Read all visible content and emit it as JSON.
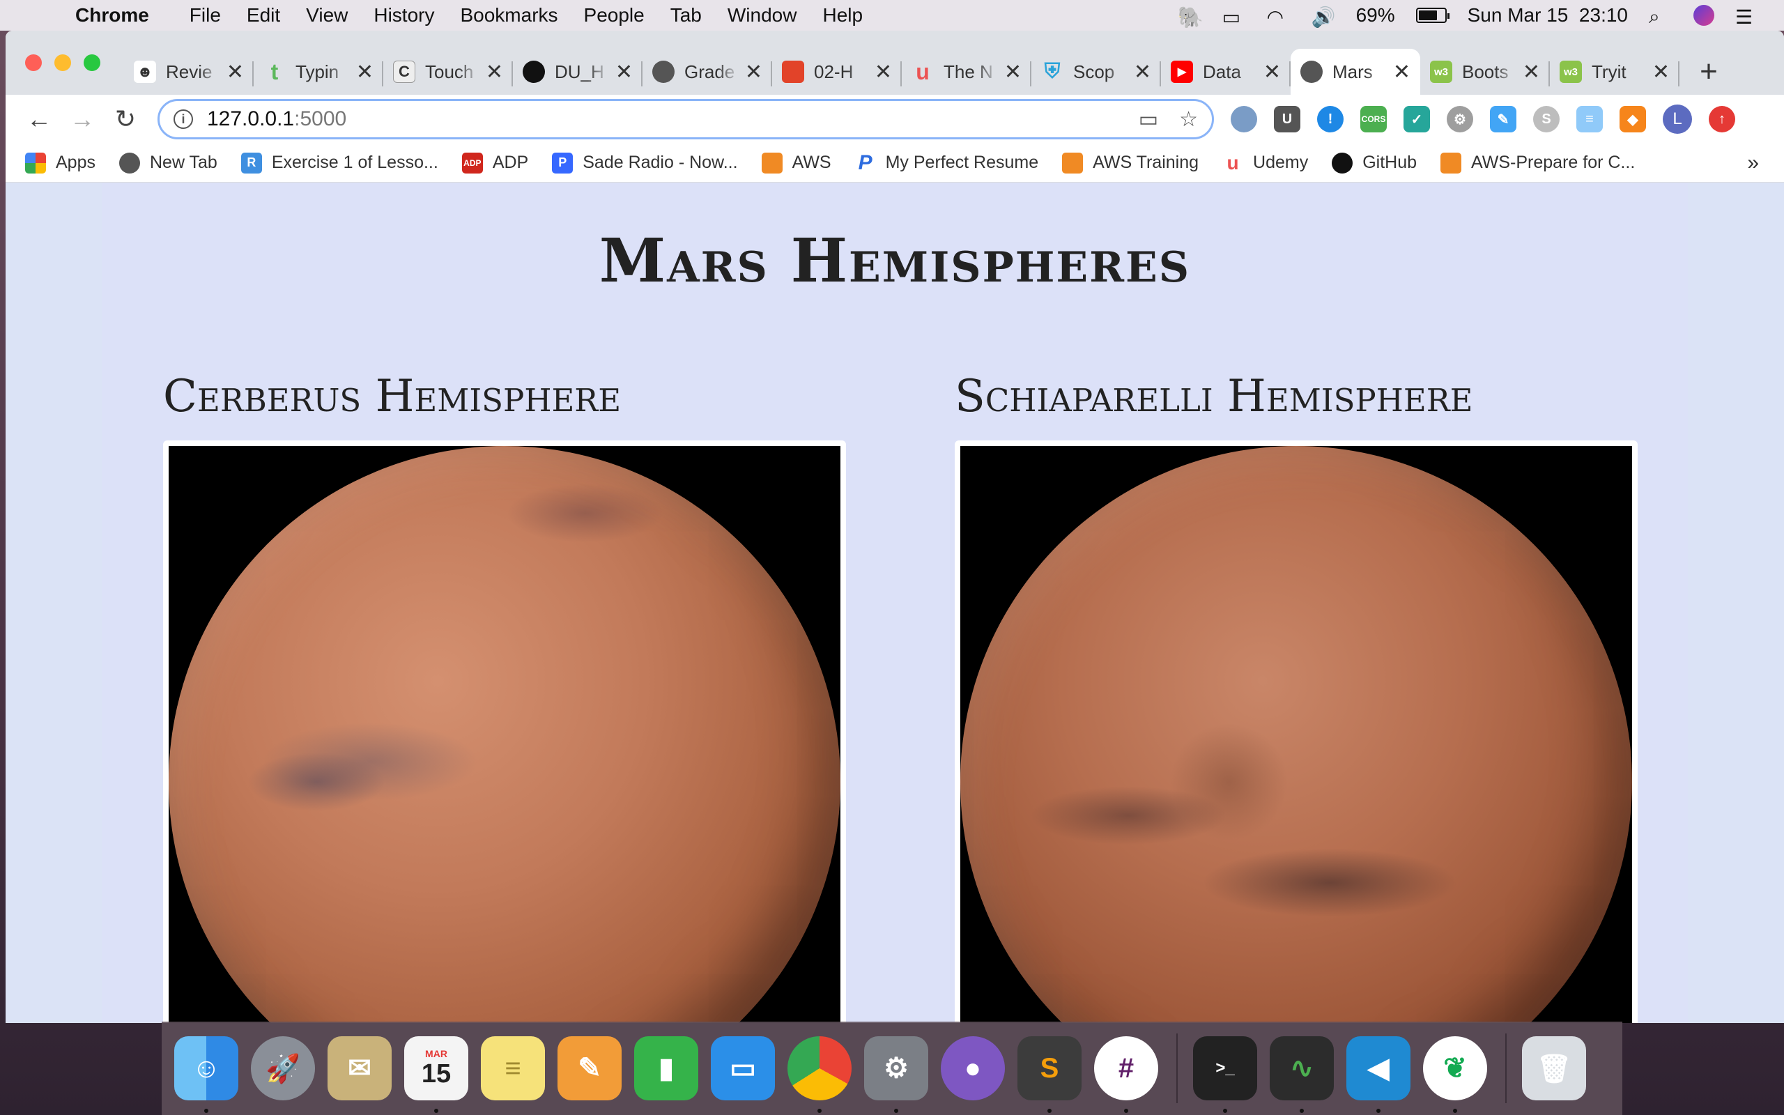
{
  "menubar": {
    "app_name": "Chrome",
    "menus": [
      "File",
      "Edit",
      "View",
      "History",
      "Bookmarks",
      "People",
      "Tab",
      "Window",
      "Help"
    ],
    "battery_percent": "69%",
    "clock": "Sun Mar 15  23:10"
  },
  "tabs": [
    {
      "title": "Revie",
      "icon_color": "#fff",
      "icon_text": "☻"
    },
    {
      "title": "Typin",
      "icon_color": "#fff",
      "icon_text": "t"
    },
    {
      "title": "Touch",
      "icon_color": "#eee",
      "icon_text": "C"
    },
    {
      "title": "DU_H",
      "icon_color": "#fff",
      "icon_text": "●"
    },
    {
      "title": "Grade",
      "icon_color": "#fff",
      "icon_text": "◍"
    },
    {
      "title": "02-H",
      "icon_color": "#fff",
      "icon_text": "◆"
    },
    {
      "title": "The N",
      "icon_color": "#fff",
      "icon_text": "u"
    },
    {
      "title": "Scop",
      "icon_color": "#fff",
      "icon_text": "⛨"
    },
    {
      "title": "Data",
      "icon_color": "#ff0000",
      "icon_text": "▶"
    },
    {
      "title": "Mars",
      "icon_color": "#fff",
      "icon_text": "◍",
      "active": true
    },
    {
      "title": "Boots",
      "icon_color": "#8bc34a",
      "icon_text": "w3"
    },
    {
      "title": "Tryit",
      "icon_color": "#8bc34a",
      "icon_text": "w3"
    }
  ],
  "toolbar": {
    "url_host": "127.0.0.1",
    "url_port": ":5000"
  },
  "bookmarks": [
    {
      "label": "Apps",
      "icon": "apps-grid-icon",
      "color": "#4285f4"
    },
    {
      "label": "New Tab",
      "icon": "globe-icon",
      "color": "#555"
    },
    {
      "label": "Exercise 1 of Lesso...",
      "icon": "exercise-icon",
      "color": "#3f8fe0"
    },
    {
      "label": "ADP",
      "icon": "adp-icon",
      "color": "#d0271d"
    },
    {
      "label": "Sade Radio - Now...",
      "icon": "pandora-icon",
      "color": "#3668ff"
    },
    {
      "label": "AWS",
      "icon": "aws-cube-icon",
      "color": "#f08a24"
    },
    {
      "label": "My Perfect Resume",
      "icon": "resume-icon",
      "color": "#2d6cdf"
    },
    {
      "label": "AWS Training",
      "icon": "aws-cube-icon",
      "color": "#f08a24"
    },
    {
      "label": "Udemy",
      "icon": "udemy-icon",
      "color": "#ec5252"
    },
    {
      "label": "GitHub",
      "icon": "github-icon",
      "color": "#111"
    },
    {
      "label": "AWS-Prepare for C...",
      "icon": "aws-cube-icon",
      "color": "#f08a24"
    }
  ],
  "page": {
    "title": "Mars Hemispheres",
    "hemispheres": [
      {
        "title": "Cerberus Hemisphere"
      },
      {
        "title": "Schiaparelli Hemisphere"
      }
    ]
  },
  "dock": [
    {
      "name": "finder",
      "color": "#2f8ae5",
      "label": "☺"
    },
    {
      "name": "launchpad",
      "color": "#8a8f98",
      "label": "🚀"
    },
    {
      "name": "mail-stamp",
      "color": "#c9b27a",
      "label": "✉"
    },
    {
      "name": "calendar",
      "color": "#f4f4f4",
      "label": "15"
    },
    {
      "name": "notes",
      "color": "#f6e27a",
      "label": "≡"
    },
    {
      "name": "pages",
      "color": "#f29c38",
      "label": "✎"
    },
    {
      "name": "numbers",
      "color": "#35b34a",
      "label": "▮"
    },
    {
      "name": "keynote",
      "color": "#2b8fe8",
      "label": "▭"
    },
    {
      "name": "chrome",
      "color": "#e8453c",
      "label": "◉"
    },
    {
      "name": "system-preferences",
      "color": "#7b7f86",
      "label": "⚙"
    },
    {
      "name": "github-desktop",
      "color": "#7e57c2",
      "label": "●"
    },
    {
      "name": "sublime-text",
      "color": "#3c3c3c",
      "label": "S"
    },
    {
      "name": "slack",
      "color": "#ffffff",
      "label": "#"
    },
    {
      "name": "terminal",
      "color": "#222",
      "label": ">_"
    },
    {
      "name": "activity-monitor",
      "color": "#2c2c2c",
      "label": "∿"
    },
    {
      "name": "vscode",
      "color": "#1f8ad2",
      "label": "◀"
    },
    {
      "name": "mongodb-compass",
      "color": "#ffffff",
      "label": "❦"
    },
    {
      "name": "trash",
      "color": "#d9dde2",
      "label": "🗑"
    }
  ],
  "calendar_month": "MAR"
}
